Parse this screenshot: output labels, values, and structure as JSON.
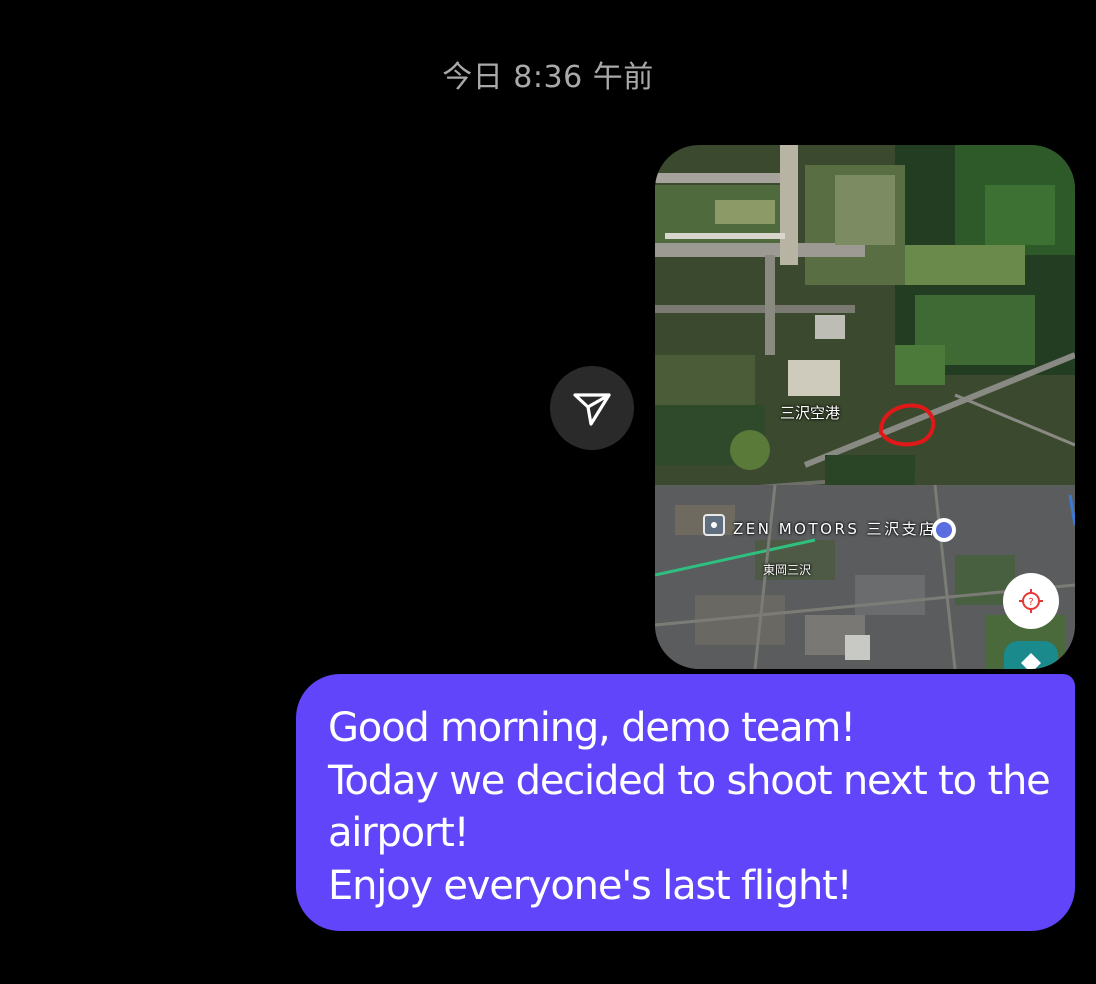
{
  "conversation": {
    "timestamp": "今日 8:36 午前"
  },
  "shared_map": {
    "labels": {
      "airport": "三沢空港",
      "business": "ZEN MOTORS 三沢支店",
      "town": "東岡三沢"
    },
    "icons": {
      "share": "send-icon",
      "locate": "locate-icon",
      "directions": "directions-icon",
      "marker": "red-circle-marker"
    }
  },
  "message": {
    "lines": [
      "Good morning, demo team!",
      "Today we decided to shoot next to the",
      "airport!",
      "Enjoy everyone's last flight!"
    ]
  },
  "colors": {
    "background": "#000000",
    "timestamp": "#a9a9a9",
    "bubble": "#6045fa",
    "bubble_text": "#ffffff",
    "share_button": "#2a2a2a",
    "marker": "#e01818",
    "directions": "#1a8a8c"
  }
}
